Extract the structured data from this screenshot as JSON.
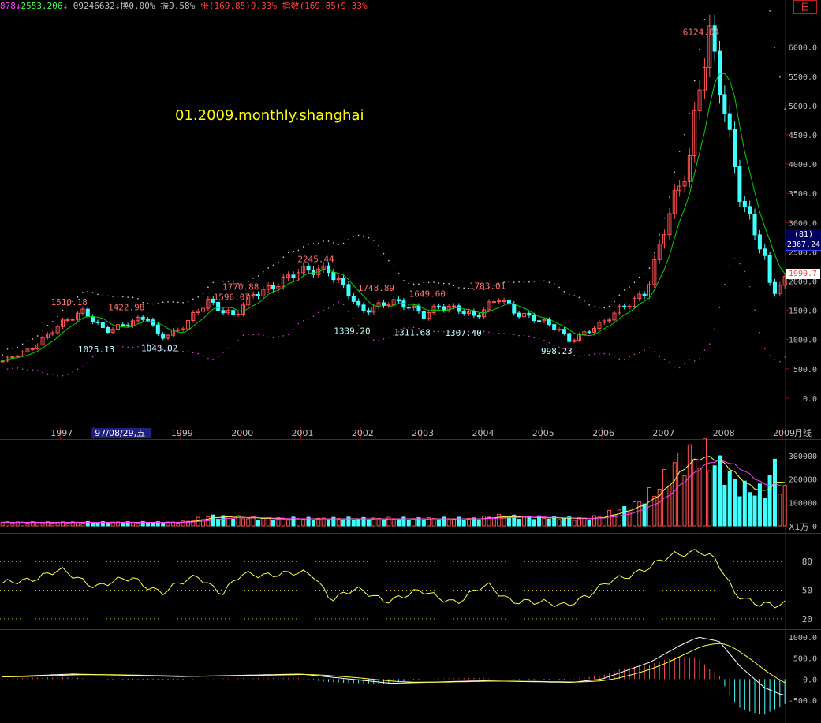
{
  "info_bar": {
    "segments": [
      {
        "text": "878",
        "color": "#ff40ff"
      },
      {
        "text": "↓",
        "color": "#ff40ff"
      },
      {
        "text": "2553.206",
        "color": "#40ff40"
      },
      {
        "text": "↓",
        "color": "#40ff40"
      },
      {
        "text": " ",
        "color": "#ffffff"
      },
      {
        "text": "09246632",
        "color": "#c0c0c0"
      },
      {
        "text": "↓",
        "color": "#c0c0c0"
      },
      {
        "text": "换0.00%",
        "color": "#c0c0c0"
      },
      {
        "text": " 振9.58%",
        "color": "#c0c0c0"
      },
      {
        "text": " 张",
        "color": "#ff4040"
      },
      {
        "text": "(169.85)9.33%",
        "color": "#ff4040"
      },
      {
        "text": " 指数",
        "color": "#ff4040"
      },
      {
        "text": "(169.85)9.33%",
        "color": "#ff4040"
      }
    ]
  },
  "period_label": "日",
  "watermark": "01.2009.monthly.shanghai",
  "badges": {
    "ma_count": "(81)",
    "ma_value": "2367.24",
    "last_price": "1990.7"
  },
  "colors": {
    "up": "#ff5050",
    "down": "#40ffff",
    "ma": "#00d000",
    "band_upper": "#d8d8d8",
    "band_lower": "#d040d0",
    "axis": "#b00000",
    "osc": "#ffff40",
    "vol_ma_short": "#ffff40",
    "vol_ma_long": "#ff40ff"
  },
  "chart_data": [
    {
      "type": "candlestick",
      "title": "",
      "ylim": [
        -500,
        6400
      ],
      "yticks": [
        "6000.0",
        "5500.0",
        "5000.0",
        "4500.0",
        "4000.0",
        "3500.0",
        "3000.0",
        "2500.0",
        "2000.0",
        "1500.0",
        "1000.0",
        "500.0",
        "0.0"
      ],
      "tick_values": [
        6000,
        5500,
        5000,
        4500,
        4000,
        3500,
        3000,
        2500,
        2000,
        1500,
        1000,
        500,
        0
      ],
      "x_start_year": 1996.0,
      "x_end_year": 2009.0,
      "months": 157,
      "xticks": [
        "1997",
        "97/08/29,五",
        "1999",
        "2000",
        "2001",
        "2002",
        "2003",
        "2004",
        "2005",
        "2006",
        "2007",
        "2008",
        "2009",
        "月线"
      ],
      "xtick_years": [
        1997.0,
        1997.55,
        1999.0,
        2000.0,
        2001.0,
        2002.0,
        2003.0,
        2004.0,
        2005.0,
        2006.0,
        2007.0,
        2008.0,
        2009.0
      ],
      "anchors": [
        [
          1996.0,
          600
        ],
        [
          1996.5,
          850
        ],
        [
          1996.95,
          1200
        ],
        [
          1997.4,
          1510
        ],
        [
          1997.75,
          1150
        ],
        [
          1998.0,
          1200
        ],
        [
          1998.45,
          1420
        ],
        [
          1998.65,
          1043
        ],
        [
          1999.0,
          1150
        ],
        [
          1999.45,
          1700
        ],
        [
          1999.7,
          1500
        ],
        [
          1999.9,
          1380
        ],
        [
          2000.2,
          1770
        ],
        [
          2000.55,
          1950
        ],
        [
          2000.9,
          2100
        ],
        [
          2001.45,
          2245
        ],
        [
          2001.75,
          1850
        ],
        [
          2002.0,
          1440
        ],
        [
          2002.5,
          1700
        ],
        [
          2002.8,
          1550
        ],
        [
          2003.05,
          1380
        ],
        [
          2003.3,
          1600
        ],
        [
          2003.6,
          1550
        ],
        [
          2003.9,
          1350
        ],
        [
          2004.3,
          1750
        ],
        [
          2004.6,
          1450
        ],
        [
          2004.9,
          1330
        ],
        [
          2005.3,
          1180
        ],
        [
          2005.45,
          1000
        ],
        [
          2005.75,
          1120
        ],
        [
          2006.0,
          1250
        ],
        [
          2006.35,
          1600
        ],
        [
          2006.75,
          1800
        ],
        [
          2007.0,
          2700
        ],
        [
          2007.25,
          3600
        ],
        [
          2007.45,
          4100
        ],
        [
          2007.6,
          5300
        ],
        [
          2007.8,
          6124
        ],
        [
          2007.95,
          5300
        ],
        [
          2008.15,
          4300
        ],
        [
          2008.3,
          3500
        ],
        [
          2008.5,
          3000
        ],
        [
          2008.7,
          2400
        ],
        [
          2008.82,
          1750
        ],
        [
          2008.92,
          1850
        ],
        [
          2009.0,
          1990
        ]
      ],
      "annotations": [
        {
          "text": "1510.18",
          "year": 1997.15,
          "value": 1510,
          "kind": "high"
        },
        {
          "text": "1025.13",
          "year": 1997.6,
          "value": 1025,
          "kind": "low"
        },
        {
          "text": "1422.98",
          "year": 1998.1,
          "value": 1423,
          "kind": "high"
        },
        {
          "text": "1043.02",
          "year": 1998.65,
          "value": 1043,
          "kind": "low"
        },
        {
          "text": "1770.88",
          "year": 2000.0,
          "value": 1770,
          "kind": "high"
        },
        {
          "text": "1596.07",
          "year": 1999.85,
          "value": 1596,
          "kind": "mid"
        },
        {
          "text": "2245.44",
          "year": 2001.25,
          "value": 2245,
          "kind": "high"
        },
        {
          "text": "1339.20",
          "year": 2001.85,
          "value": 1339,
          "kind": "low"
        },
        {
          "text": "1748.89",
          "year": 2002.25,
          "value": 1749,
          "kind": "high"
        },
        {
          "text": "1311.68",
          "year": 2002.85,
          "value": 1312,
          "kind": "low"
        },
        {
          "text": "1649.60",
          "year": 2003.1,
          "value": 1650,
          "kind": "high"
        },
        {
          "text": "1307.40",
          "year": 2003.7,
          "value": 1307,
          "kind": "low"
        },
        {
          "text": "1783.01",
          "year": 2004.1,
          "value": 1783,
          "kind": "high"
        },
        {
          "text": "998.23",
          "year": 2005.25,
          "value": 998,
          "kind": "low"
        },
        {
          "text": "6124.04",
          "year": 2007.65,
          "value": 6124,
          "kind": "high"
        }
      ]
    },
    {
      "type": "bar",
      "title": "",
      "ylim": [
        0,
        340000
      ],
      "yticks": [
        "300000",
        "200000",
        "100000",
        "0"
      ],
      "tick_values": [
        300000,
        200000,
        100000,
        0
      ],
      "unit": "X1万",
      "anchors": [
        [
          1996.0,
          15000
        ],
        [
          1999.0,
          15000
        ],
        [
          1999.5,
          40000
        ],
        [
          2000.5,
          30000
        ],
        [
          2003.9,
          30000
        ],
        [
          2004.2,
          40000
        ],
        [
          2005.8,
          30000
        ],
        [
          2006.5,
          80000
        ],
        [
          2006.9,
          150000
        ],
        [
          2007.3,
          280000
        ],
        [
          2007.7,
          300000
        ],
        [
          2008.0,
          240000
        ],
        [
          2008.3,
          160000
        ],
        [
          2008.7,
          140000
        ],
        [
          2008.85,
          260000
        ],
        [
          2009.0,
          150000
        ]
      ]
    },
    {
      "type": "line",
      "title": "",
      "ylim": [
        10,
        100
      ],
      "yticks": [
        "80",
        "50",
        "20"
      ],
      "tick_values": [
        80,
        50,
        20
      ],
      "anchors": [
        [
          1996.0,
          55
        ],
        [
          1997.0,
          70
        ],
        [
          1997.6,
          55
        ],
        [
          1998.2,
          62
        ],
        [
          1998.7,
          48
        ],
        [
          1999.3,
          65
        ],
        [
          1999.7,
          47
        ],
        [
          2000.0,
          65
        ],
        [
          2000.6,
          68
        ],
        [
          2001.2,
          66
        ],
        [
          2001.5,
          42
        ],
        [
          2001.9,
          50
        ],
        [
          2002.4,
          40
        ],
        [
          2003.0,
          48
        ],
        [
          2003.6,
          38
        ],
        [
          2004.1,
          55
        ],
        [
          2004.5,
          40
        ],
        [
          2004.9,
          36
        ],
        [
          2005.4,
          36
        ],
        [
          2005.8,
          44
        ],
        [
          2006.2,
          62
        ],
        [
          2006.8,
          73
        ],
        [
          2007.2,
          88
        ],
        [
          2007.6,
          92
        ],
        [
          2007.9,
          80
        ],
        [
          2008.2,
          48
        ],
        [
          2008.6,
          36
        ],
        [
          2008.9,
          32
        ],
        [
          2009.0,
          35
        ]
      ]
    },
    {
      "type": "bar",
      "title": "",
      "ylim": [
        -950,
        1150
      ],
      "yticks": [
        "1000.0",
        "500.0",
        "0.0",
        "-500.0"
      ],
      "tick_values": [
        1000,
        500,
        0,
        -500
      ],
      "anchors": [
        [
          1996.0,
          50
        ],
        [
          1997.2,
          120
        ],
        [
          1999.0,
          60
        ],
        [
          2001.0,
          120
        ],
        [
          2002.5,
          -100
        ],
        [
          2004.0,
          -40
        ],
        [
          2005.5,
          -80
        ],
        [
          2006.0,
          0
        ],
        [
          2006.8,
          400
        ],
        [
          2007.3,
          800
        ],
        [
          2007.6,
          1000
        ],
        [
          2007.95,
          900
        ],
        [
          2008.3,
          300
        ],
        [
          2008.7,
          -200
        ],
        [
          2009.0,
          -380
        ]
      ]
    }
  ]
}
